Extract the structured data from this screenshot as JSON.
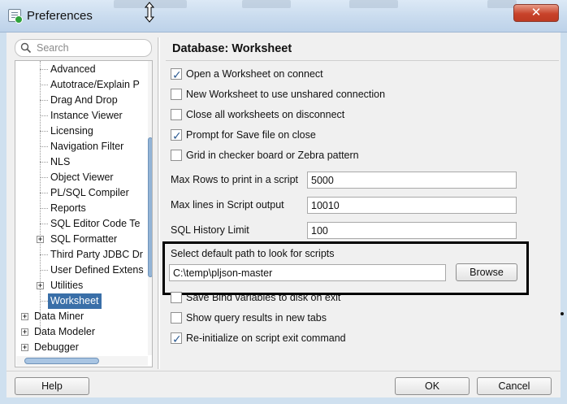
{
  "window": {
    "title": "Preferences",
    "close_glyph": "✕"
  },
  "search": {
    "placeholder": "Search"
  },
  "tree": {
    "items": [
      {
        "label": "Advanced",
        "level": 2
      },
      {
        "label": "Autotrace/Explain P",
        "level": 2
      },
      {
        "label": "Drag And Drop",
        "level": 2
      },
      {
        "label": "Instance Viewer",
        "level": 2
      },
      {
        "label": "Licensing",
        "level": 2
      },
      {
        "label": "Navigation Filter",
        "level": 2
      },
      {
        "label": "NLS",
        "level": 2
      },
      {
        "label": "Object Viewer",
        "level": 2
      },
      {
        "label": "PL/SQL Compiler",
        "level": 2
      },
      {
        "label": "Reports",
        "level": 2
      },
      {
        "label": "SQL Editor Code Te",
        "level": 2
      },
      {
        "label": "SQL Formatter",
        "level": 2,
        "expandable": true
      },
      {
        "label": "Third Party JDBC Dr",
        "level": 2
      },
      {
        "label": "User Defined Extens",
        "level": 2
      },
      {
        "label": "Utilities",
        "level": 2,
        "expandable": true
      },
      {
        "label": "Worksheet",
        "level": 2,
        "selected": true
      },
      {
        "label": "Data Miner",
        "level": 1,
        "expandable": true
      },
      {
        "label": "Data Modeler",
        "level": 1,
        "expandable": true
      },
      {
        "label": "Debugger",
        "level": 1,
        "expandable": true
      }
    ]
  },
  "panel": {
    "title": "Database: Worksheet",
    "checkboxes": [
      {
        "label": "Open a Worksheet on connect",
        "checked": true
      },
      {
        "label": "New Worksheet to use unshared connection",
        "checked": false
      },
      {
        "label": "Close all worksheets on disconnect",
        "checked": false
      },
      {
        "label": "Prompt for Save file on close",
        "checked": true
      },
      {
        "label": "Grid in checker board or Zebra pattern",
        "checked": false
      }
    ],
    "fields": [
      {
        "label": "Max Rows to print in a script",
        "value": "5000"
      },
      {
        "label": "Max lines in Script output",
        "value": "10010"
      },
      {
        "label": "SQL History Limit",
        "value": "100"
      }
    ],
    "path": {
      "label": "Select default path to look for scripts",
      "value": "C:\\temp\\pljson-master",
      "browse_label": "Browse"
    },
    "checkboxes2": [
      {
        "label": "Save Bind variables to disk on exit",
        "checked": false
      },
      {
        "label": "Show query results in new tabs",
        "checked": false
      },
      {
        "label": "Re-initialize on script exit command",
        "checked": true
      }
    ]
  },
  "footer": {
    "help_label": "Help",
    "ok_label": "OK",
    "cancel_label": "Cancel"
  },
  "colors": {
    "selection": "#3a6fa8",
    "titlebar": "#c9dbee",
    "close": "#c8432b"
  },
  "icons": {
    "app": "preferences-icon",
    "search": "search-icon",
    "check": "check-icon",
    "expander": "plus-icon"
  }
}
